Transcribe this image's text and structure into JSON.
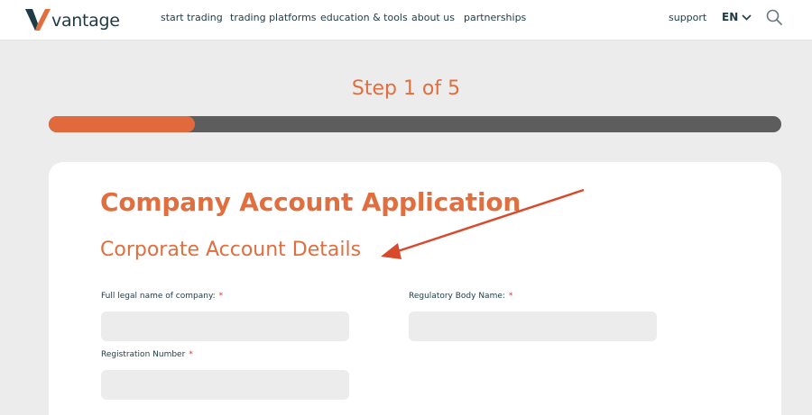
{
  "nav": {
    "logo_text": "vantage",
    "links": [
      "start trading",
      "trading platforms",
      "education & tools",
      "about us",
      "partnerships"
    ],
    "support": "support",
    "language": "EN"
  },
  "step": {
    "label": "Step 1 of 5",
    "progress": 0.2
  },
  "form": {
    "title": "Company Account Application",
    "subtitle": "Corporate Account Details",
    "fields": [
      {
        "label": "Full legal name of company:",
        "required": "*",
        "value": ""
      },
      {
        "label": "Regulatory Body Name:",
        "required": "*",
        "value": ""
      },
      {
        "label": "Registration Number",
        "required": "*",
        "value": ""
      }
    ]
  },
  "colors": {
    "accent": "#e06e3f",
    "navy": "#1e3b46",
    "track": "#5d5d5d",
    "annotation_arrow": "#d94a2c"
  }
}
